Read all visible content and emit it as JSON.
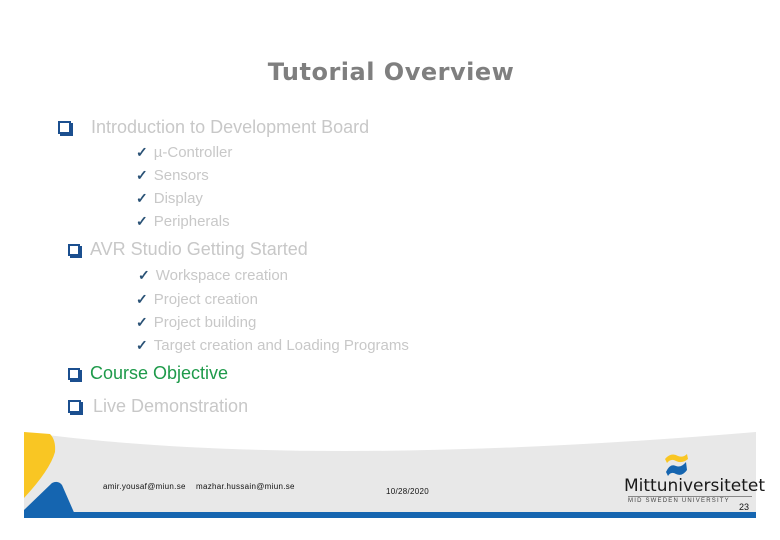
{
  "slide": {
    "title": "Tutorial Overview",
    "sections": [
      {
        "label": "Introduction to Development  Board",
        "color": "#c8c8c8",
        "items": [
          "µ-Controller",
          "Sensors",
          "Display",
          "Peripherals"
        ]
      },
      {
        "label": "AVR Studio Getting Started",
        "color": "#c8c8c8",
        "items": [
          " Workspace creation",
          "Project creation",
          "Project building",
          "Target creation and Loading Programs"
        ]
      },
      {
        "label": "Course Objective",
        "color": "#1e9a4a",
        "items": []
      },
      {
        "label": " Live Demonstration",
        "color": "#c8c8c8",
        "items": []
      }
    ],
    "icons": {
      "bullet": "hollow-square-bullet",
      "sub_bullet": "checkmark"
    },
    "check_glyph": "✓"
  },
  "footer": {
    "email_1": "amir.yousaf@miun.se",
    "email_2": "mazhar.hussain@miun.se",
    "date": "10/28/2020",
    "page_number": "23",
    "logo_name": "Mittuniversitetet",
    "logo_subtitle": "MID SWEDEN UNIVERSITY",
    "colors": {
      "yellow": "#f9c623",
      "blue": "#1565b0",
      "band": "#e8e8e8"
    }
  }
}
